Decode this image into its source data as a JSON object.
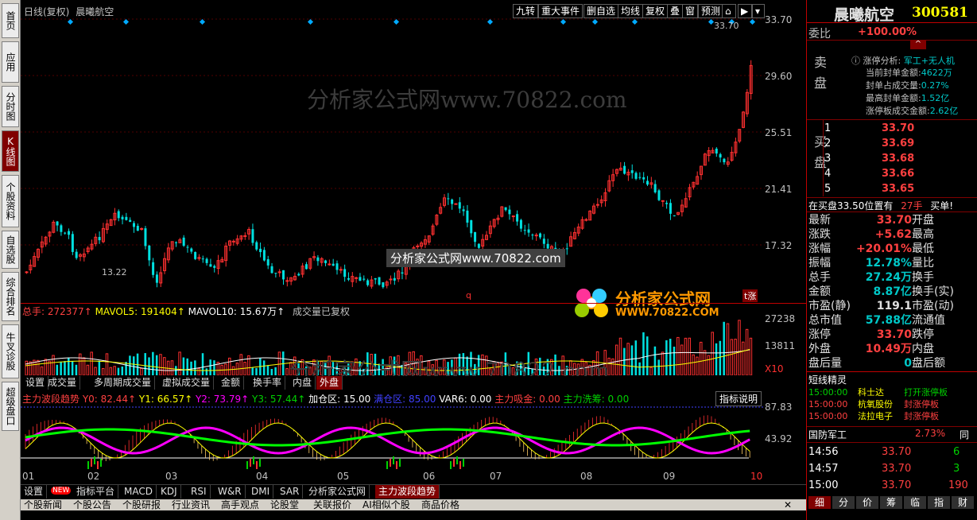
{
  "left_tabs": [
    "首页",
    "应用",
    "分时图",
    "K线图",
    "个股资料",
    "自选股",
    "综合排名",
    "牛叉诊股",
    "超级盘口"
  ],
  "header": {
    "period": "日线(复权)",
    "name": "晨曦航空"
  },
  "toolbar": [
    "九转",
    "重大事件",
    "删自选",
    "均线",
    "复权",
    "叠",
    "窗",
    "预测"
  ],
  "price_axis": [
    "33.70",
    "29.60",
    "25.51",
    "21.41",
    "17.32"
  ],
  "price_labels": {
    "high": "33.70",
    "low": "13.22",
    "extra": "q",
    "tag": "t涨"
  },
  "volume": {
    "title": "总手: 272377↑",
    "ma5": "MAVOL5: 191404↑",
    "ma10": "MAVOL10: 15.67万↑",
    "note": "成交量已复权",
    "axis": [
      "27238",
      "13811",
      "X10"
    ]
  },
  "vol_tabs": [
    "设置",
    "成交量",
    "多周期成交量",
    "虚拟成交量",
    "金额",
    "换手率",
    "内盘",
    "外盘"
  ],
  "indicator": {
    "title": "主力波段趋势",
    "y0": "Y0: 82.44↑",
    "y1": "Y1: 66.57↑",
    "y2": "Y2: 73.79↑",
    "y3": "Y3: 57.44↑",
    "jcq": "加仓区: 15.00",
    "mtq": "满仓区: 85.00",
    "var6": "VAR6: 0.00",
    "zljj": "主力吸金: 0.00",
    "zlxc": "主力洗筹: 0.00",
    "explain": "指标说明",
    "axis": [
      "87.83",
      "43.92"
    ]
  },
  "months": [
    "01",
    "02",
    "03",
    "04",
    "05",
    "06",
    "07",
    "08",
    "09",
    "10"
  ],
  "bottom_tabs": [
    "设置",
    "NEW",
    "指标平台",
    "MACD",
    "KDJ",
    "RSI",
    "W&R",
    "DMI",
    "SAR",
    "分析家公式网",
    "主力波段趋势"
  ],
  "news_tabs": [
    "个股新闻",
    "个股公告",
    "个股研报",
    "行业资讯",
    "高手观点",
    "论股堂",
    "关联报价",
    "AI相似个股",
    "商品价格"
  ],
  "watermark": {
    "text1": "分析家公式网www.70822.com",
    "text2": "分析家公式网www.70822.com",
    "brand": "分析家公式网",
    "brand_url": "WWW.70822.COM"
  },
  "right": {
    "title": "晨曦航空",
    "code": "300581",
    "weibi_label": "委比",
    "weibi": "+100.00%",
    "sell_label": "卖盘",
    "buy_label": "买盘",
    "zt_title": "涨停分析:",
    "zt_tag": "军工+无人机",
    "zt_rows": [
      [
        "当前封单金额:",
        "4622万"
      ],
      [
        "封单占成交量:",
        "0.27%"
      ],
      [
        "最高封单金额:",
        "1.52亿"
      ],
      [
        "涨停板成交金额:",
        "2.62亿"
      ]
    ],
    "bids": [
      [
        "1",
        "33.70"
      ],
      [
        "2",
        "33.69"
      ],
      [
        "3",
        "33.68"
      ],
      [
        "4",
        "33.66"
      ],
      [
        "5",
        "33.65"
      ]
    ],
    "bid_note": "在买盘33.50位置有",
    "bid_note_qty": "27手",
    "bid_note_end": "买单!",
    "stats": [
      [
        "最新",
        "33.70",
        "开盘",
        ""
      ],
      [
        "涨跌",
        "+5.62",
        "最高",
        ""
      ],
      [
        "涨幅",
        "+20.01%",
        "最低",
        ""
      ],
      [
        "振幅",
        "12.78%",
        "量比",
        ""
      ],
      [
        "总手",
        "27.24万",
        "换手",
        ""
      ],
      [
        "金额",
        "8.87亿",
        "换手(实)",
        ""
      ],
      [
        "市盈(静)",
        "119.1",
        "市盈(动)",
        ""
      ],
      [
        "总市值",
        "57.88亿",
        "流通值",
        ""
      ],
      [
        "涨停",
        "33.70",
        "跌停",
        ""
      ],
      [
        "外盘",
        "10.49万",
        "内盘",
        ""
      ],
      [
        "盘后量",
        "0",
        "盘后额",
        ""
      ]
    ],
    "short_title": "短线精灵",
    "short_rows": [
      [
        "15:00:00",
        "科士达",
        "打开涨停板"
      ],
      [
        "15:00:00",
        "杭氧股份",
        "封涨停板"
      ],
      [
        "15:00:00",
        "法拉电子",
        "封涨停板"
      ]
    ],
    "sector": "国防军工",
    "sector_pct": "2.73%",
    "sector_extra": "同",
    "ticks": [
      [
        "14:56",
        "33.70",
        "6"
      ],
      [
        "14:57",
        "33.70",
        "3"
      ],
      [
        "15:00",
        "33.70",
        "190"
      ]
    ],
    "bottom_tabs": [
      "细",
      "分",
      "价",
      "筹",
      "临",
      "指",
      "财"
    ]
  },
  "colors": {
    "up": "#ff3030",
    "down": "#00e0e0",
    "ma_white": "#ffffff",
    "ma_yellow": "#ffff00",
    "magenta": "#ff00ff",
    "green": "#00ff00"
  }
}
